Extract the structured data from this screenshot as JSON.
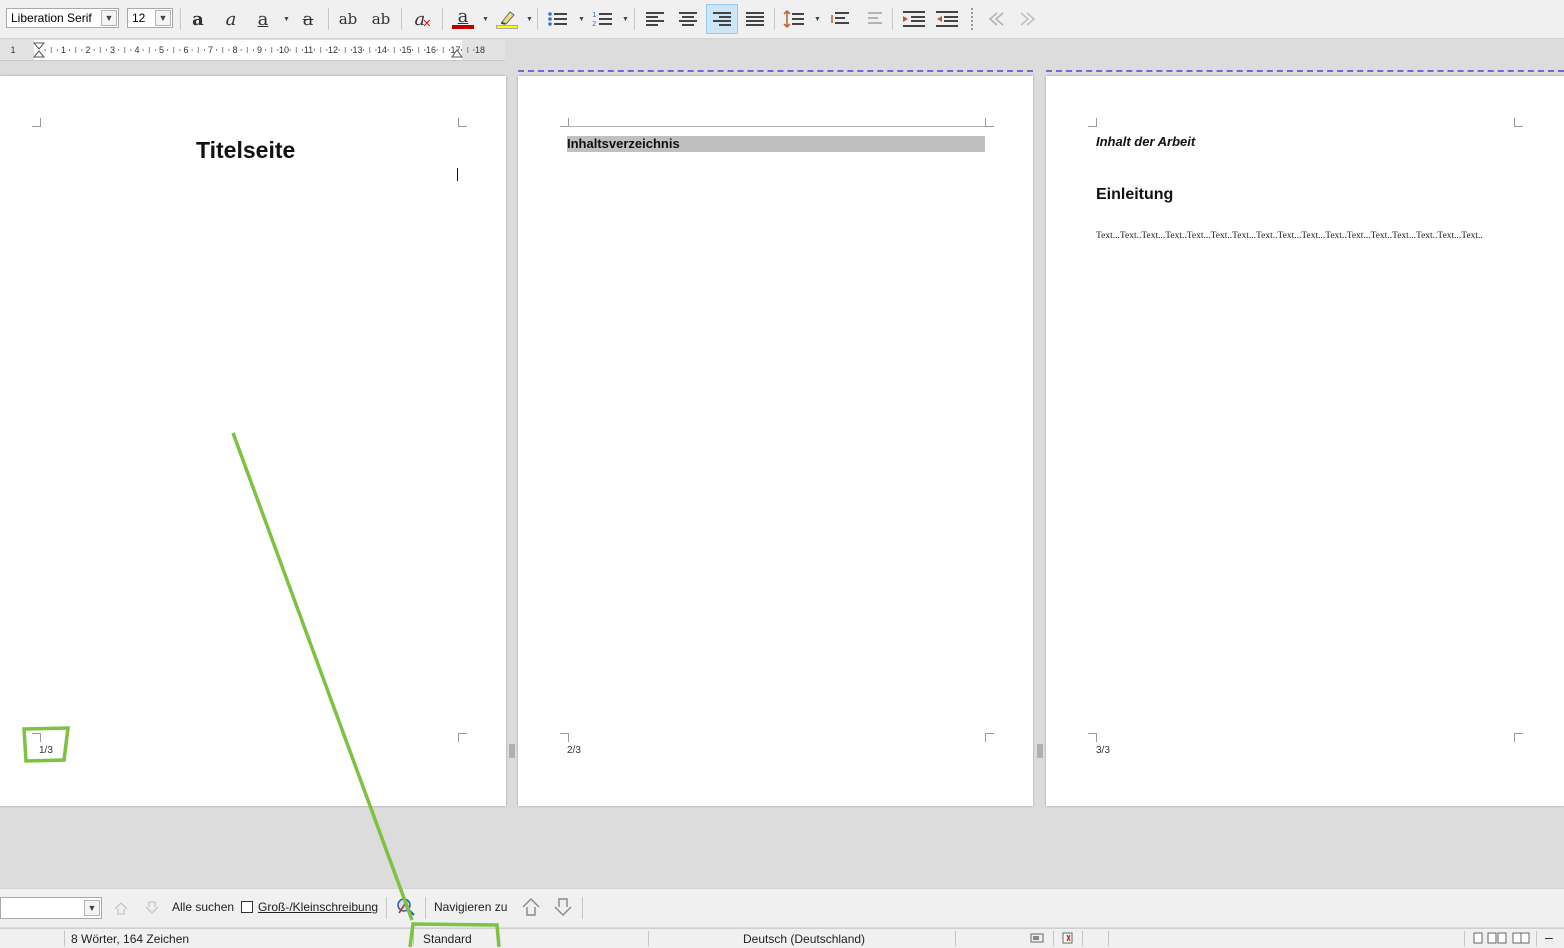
{
  "toolbar": {
    "font_name": "Liberation Serif",
    "font_size": "12",
    "buttons": {
      "bold": "a",
      "italic": "a",
      "underline": "a",
      "strikethrough": "a",
      "superscript": "ab",
      "subscript": "ab",
      "clear_formatting": "a",
      "font_color": "a"
    },
    "colors": {
      "font_color": "#c00000",
      "highlight": "#ffff00",
      "active_bg": "#cde6f7"
    }
  },
  "ruler": {
    "ticks": [
      "1",
      "1",
      "2",
      "3",
      "4",
      "5",
      "6",
      "7",
      "8",
      "9",
      "10",
      "11",
      "12",
      "13",
      "14",
      "15",
      "16",
      "17",
      "18"
    ]
  },
  "pages": {
    "page1": {
      "title": "Titelseite",
      "page_number": "1/3"
    },
    "page2": {
      "toc_heading": "Inhaltsverzeichnis",
      "page_number": "2/3"
    },
    "page3": {
      "section_heading": "Inhalt der Arbeit",
      "heading": "Einleitung",
      "body": "Text...Text..Text...Text..Text...Text..Text...Text..Text...Text...Text..Text...Text..Text...Text..Text...Text..",
      "page_number": "3/3"
    }
  },
  "findbar": {
    "find_all": "Alle suchen",
    "match_case": "Groß-/Kleinschreibung",
    "navigate_to": "Navigieren zu"
  },
  "statusbar": {
    "word_count": "8 Wörter, 164 Zeichen",
    "page_style": "Standard",
    "language": "Deutsch (Deutschland)"
  },
  "annotation": {
    "color": "#7dc242"
  }
}
